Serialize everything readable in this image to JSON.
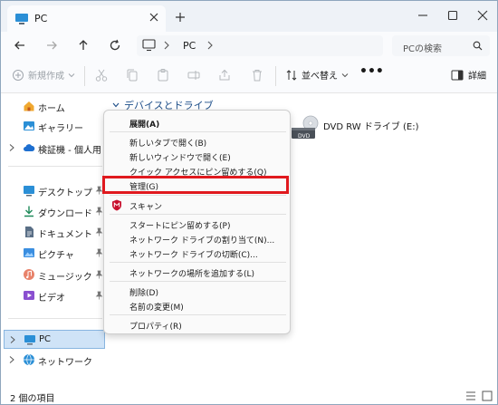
{
  "tab": {
    "label": "PC"
  },
  "address": {
    "segment": "PC"
  },
  "search": {
    "placeholder": "PCの検索"
  },
  "toolbar": {
    "new_label": "新規作成",
    "sort_label": "並べ替え",
    "more_label": "•••",
    "detail_label": "詳細"
  },
  "nav": {
    "items": [
      {
        "label": "ホーム"
      },
      {
        "label": "ギャラリー"
      },
      {
        "label": "検証機 - 個人用"
      },
      {
        "label": "デスクトップ"
      },
      {
        "label": "ダウンロード"
      },
      {
        "label": "ドキュメント"
      },
      {
        "label": "ピクチャ"
      },
      {
        "label": "ミュージック"
      },
      {
        "label": "ビデオ"
      },
      {
        "label": "PC"
      },
      {
        "label": "ネットワーク"
      }
    ]
  },
  "content": {
    "group_title": "デバイスとドライブ",
    "drive_label": "DVD RW ドライブ (E:)",
    "drive_badge": "DVD"
  },
  "status": {
    "text": "2 個の項目"
  },
  "menu": {
    "items": [
      "展開(A)",
      "新しいタブで開く(B)",
      "新しいウィンドウで開く(E)",
      "クイック アクセスにピン留めする(Q)",
      "管理(G)",
      "スキャン",
      "スタートにピン留めする(P)",
      "ネットワーク ドライブの割り当て(N)...",
      "ネットワーク ドライブの切断(C)...",
      "ネットワークの場所を追加する(L)",
      "削除(D)",
      "名前の変更(M)",
      "プロパティ(R)"
    ]
  },
  "colors": {
    "highlight": "#e0191e",
    "selection": "#cfe3f7",
    "accent": "#1d4e89"
  }
}
